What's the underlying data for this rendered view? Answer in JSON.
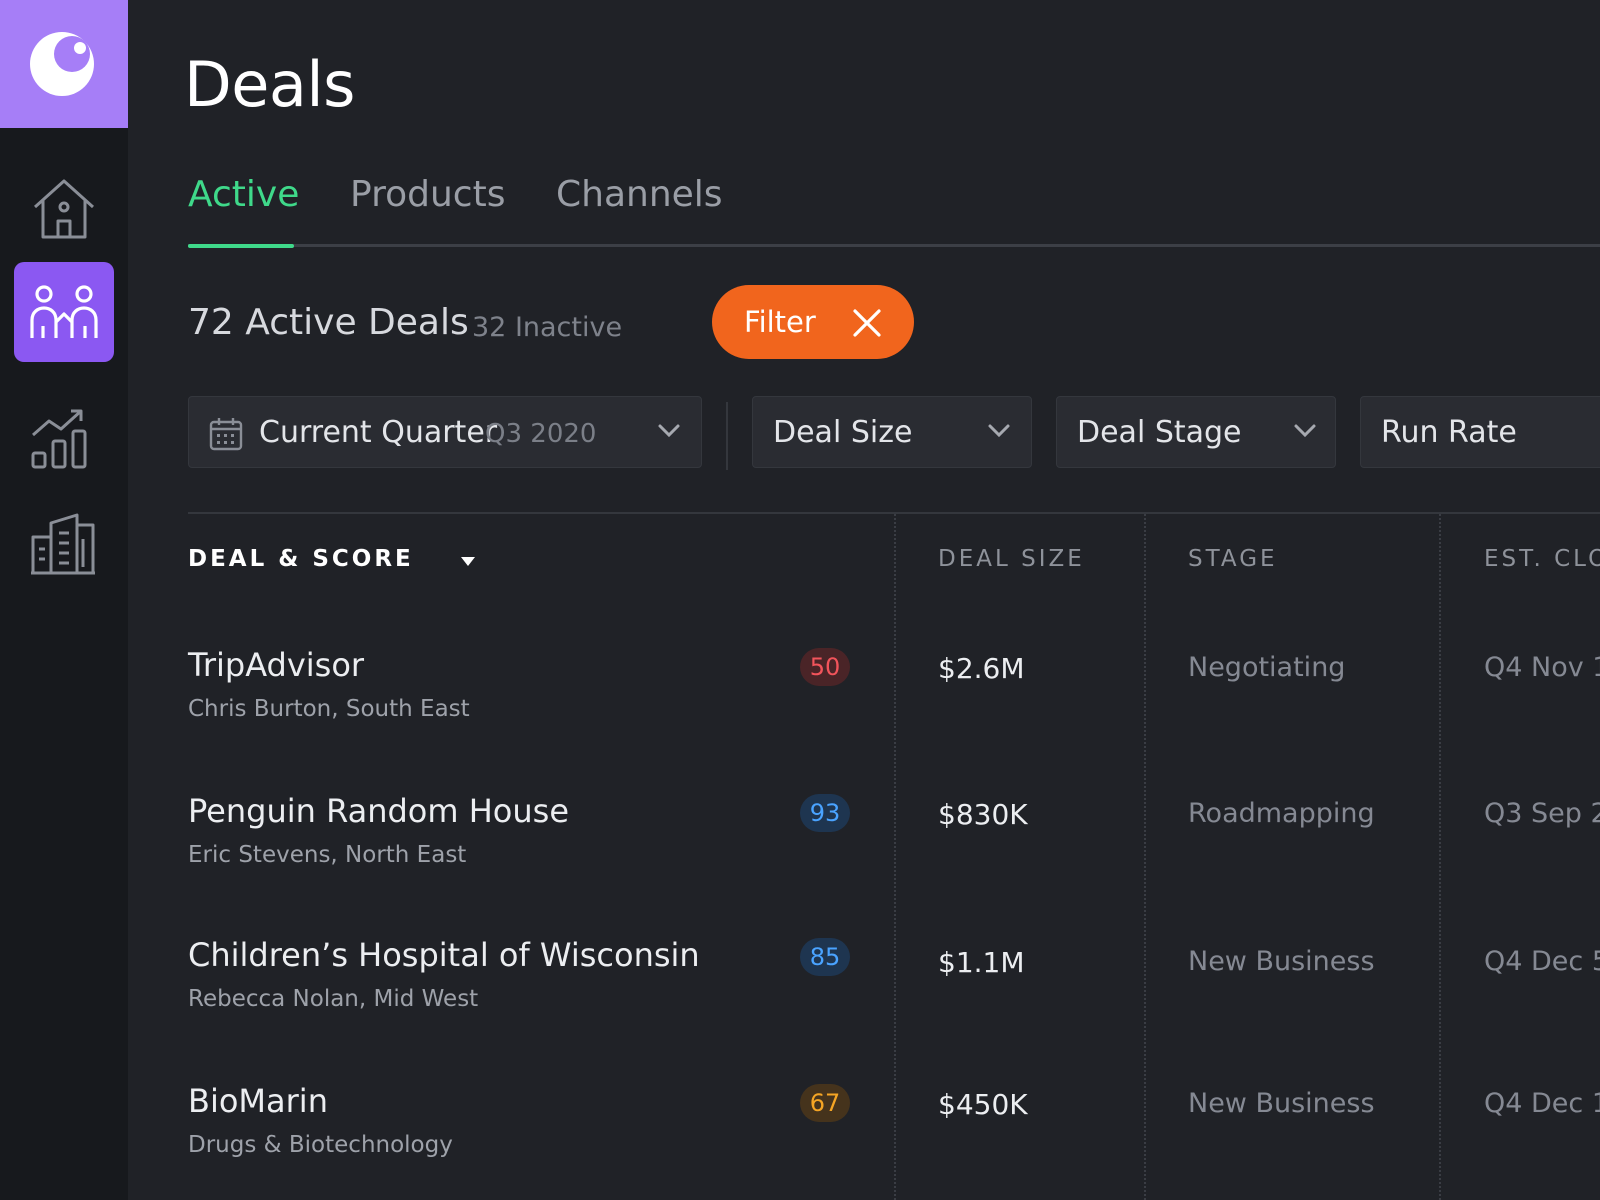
{
  "sidebar": {
    "logo_icon": "brand-c-logo",
    "items": [
      {
        "icon": "home-icon",
        "active": false
      },
      {
        "icon": "people-icon",
        "active": true
      },
      {
        "icon": "analytics-icon",
        "active": false
      },
      {
        "icon": "buildings-icon",
        "active": false
      }
    ],
    "colors": {
      "logo_bg": "#a67ef7",
      "active_bg": "#8b58f2"
    }
  },
  "page": {
    "title": "Deals"
  },
  "tabs": [
    {
      "label": "Active",
      "active": true
    },
    {
      "label": "Products",
      "active": false
    },
    {
      "label": "Channels",
      "active": false
    }
  ],
  "summary": {
    "active": "72 Active Deals",
    "inactive": "32 Inactive",
    "filter_label": "Filter"
  },
  "filters": {
    "quarter": {
      "label": "Current Quarter",
      "sub": "Q3 2020"
    },
    "deal_size": {
      "label": "Deal Size"
    },
    "deal_stage": {
      "label": "Deal Stage"
    },
    "run_rate": {
      "label": "Run Rate"
    }
  },
  "table": {
    "headers": {
      "deal": "DEAL & SCORE",
      "size": "DEAL SIZE",
      "stage": "STAGE",
      "close": "EST. CLO"
    },
    "rows": [
      {
        "name": "TripAdvisor",
        "sub": "Chris Burton, South East",
        "score": "50",
        "size": "$2.6M",
        "stage": "Negotiating",
        "close": "Q4  Nov 1"
      },
      {
        "name": "Penguin Random House",
        "sub": "Eric Stevens, North East",
        "score": "93",
        "size": "$830K",
        "stage": "Roadmapping",
        "close": "Q3 Sep 2"
      },
      {
        "name": "Children’s Hospital of Wisconsin",
        "sub": "Rebecca Nolan, Mid West",
        "score": "85",
        "size": "$1.1M",
        "stage": "New Business",
        "close": "Q4  Dec 5"
      },
      {
        "name": "BioMarin",
        "sub": "Drugs & Biotechnology",
        "score": "67",
        "size": "$450K",
        "stage": "New Business",
        "close": "Q4  Dec 1"
      }
    ]
  },
  "colors": {
    "accent_green": "#3fd98a",
    "filter_orange": "#f1651d",
    "score_red": "#f2545b",
    "score_blue": "#4aa3ff",
    "score_amber": "#f5a524"
  }
}
